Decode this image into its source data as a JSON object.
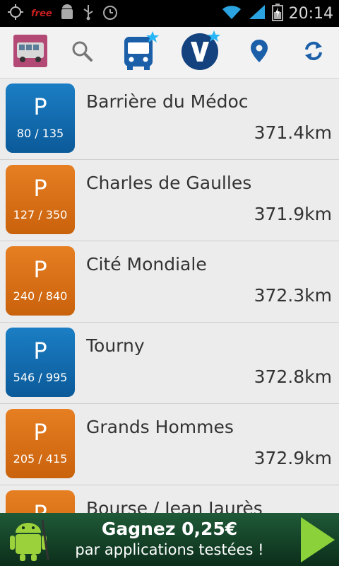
{
  "status_bar": {
    "free_label": "free",
    "time": "20:14"
  },
  "toolbar": {
    "icons": [
      "bus-photo-icon",
      "search-icon",
      "bus-favorite-icon",
      "v-favorite-icon",
      "location-pin-icon",
      "refresh-icon"
    ],
    "accent": "#1b5fa8"
  },
  "parkings": [
    {
      "name": "Barrière du Médoc",
      "capacity": "80 / 135",
      "distance": "371.4km",
      "color": "blue"
    },
    {
      "name": "Charles de Gaulles",
      "capacity": "127 / 350",
      "distance": "371.9km",
      "color": "orange"
    },
    {
      "name": "Cité Mondiale",
      "capacity": "240 / 840",
      "distance": "372.3km",
      "color": "orange"
    },
    {
      "name": "Tourny",
      "capacity": "546 / 995",
      "distance": "372.8km",
      "color": "blue"
    },
    {
      "name": "Grands Hommes",
      "capacity": "205 / 415",
      "distance": "372.9km",
      "color": "orange"
    },
    {
      "name": "Bourse / Jean Jaurès",
      "capacity": "",
      "distance": "",
      "color": "orange"
    }
  ],
  "badge_letter": "P",
  "ad": {
    "line1": "Gagnez 0,25€",
    "line2": "par applications testées !"
  }
}
